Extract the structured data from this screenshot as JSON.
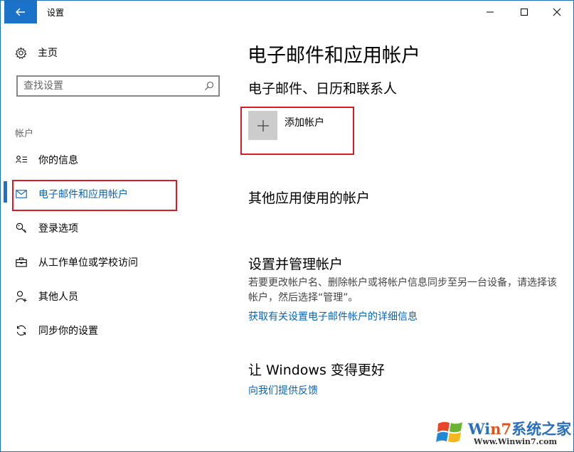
{
  "titlebar": {
    "app_title": "设置"
  },
  "sidebar": {
    "home_label": "主页",
    "search": {
      "placeholder": "查找设置"
    },
    "section_label": "帐户",
    "items": [
      {
        "label": "你的信息",
        "icon": "person-card-icon"
      },
      {
        "label": "电子邮件和应用帐户",
        "icon": "mail-icon",
        "active": true
      },
      {
        "label": "登录选项",
        "icon": "key-icon"
      },
      {
        "label": "从工作单位或学校访问",
        "icon": "briefcase-icon"
      },
      {
        "label": "其他人员",
        "icon": "person-add-icon"
      },
      {
        "label": "同步你的设置",
        "icon": "sync-icon"
      }
    ]
  },
  "main": {
    "page_title": "电子邮件和应用帐户",
    "email_section_title": "电子邮件、日历和联系人",
    "add_account_label": "添加帐户",
    "other_apps_title": "其他应用使用的帐户",
    "manage_title": "设置并管理帐户",
    "manage_desc": "若要更改帐户名、删除帐户或将帐户信息同步至另一台设备，请选择该帐户，然后选择“管理”。",
    "manage_link": "获取有关设置电子邮件帐户的详细信息",
    "improve_title": "让 Windows 变得更好",
    "feedback_link": "向我们提供反馈"
  },
  "watermark": {
    "title_prefix": "Wi",
    "title_seven": "n7",
    "title_suffix": "系统之家",
    "url": "Www.Winwin7.com"
  },
  "colors": {
    "accent": "#1a73c8",
    "link": "#0a63b5",
    "highlight_box": "#d91a28"
  }
}
